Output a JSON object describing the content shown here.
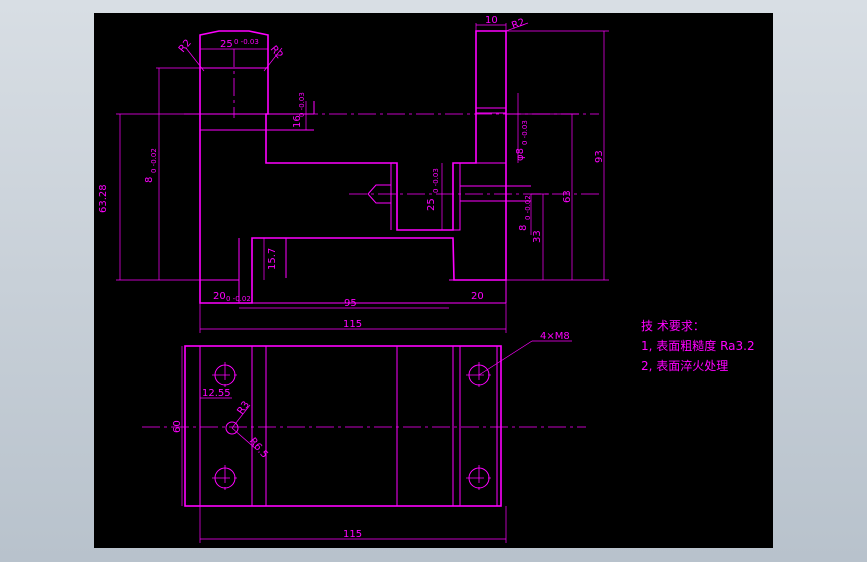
{
  "colors": {
    "background": "#000000",
    "lines": "#ff00ff",
    "frame": "#c8d0d8"
  },
  "front_view": {
    "dim_r2_left": "R2",
    "dim_r2_right": "R2",
    "dim_25": "25",
    "dim_25_tol": "0 -0.03",
    "dim_r2_top": "R2",
    "dim_10": "10",
    "dim_16": "16",
    "dim_16_tol": "0 -0.03",
    "dim_phi8": "φ8",
    "dim_phi8_tol": "0 -0.03",
    "dim_8": "8",
    "dim_8_tol": "0 -0.02",
    "dim_25b": "25",
    "dim_25b_tol": "0 -0.03",
    "dim_8b": "8",
    "dim_8b_tol": "0 -0.02",
    "dim_63_28": "63.28",
    "dim_93": "93",
    "dim_63": "63",
    "dim_33": "33",
    "dim_15_7": "15.7",
    "dim_20": "20",
    "dim_20_tol": "0 -0.02",
    "dim_95": "95",
    "dim_20b": "20",
    "dim_115": "115"
  },
  "top_view": {
    "dim_4xm8": "4×M8",
    "dim_12_55": "12.55",
    "dim_r3": "R3",
    "dim_r6_5": "R6.5",
    "dim_60": "60",
    "dim_115": "115"
  },
  "notes": {
    "title": "技 术要求：",
    "line1": "1, 表面粗糙度 Ra3.2",
    "line2": "2, 表面淬火处理"
  }
}
